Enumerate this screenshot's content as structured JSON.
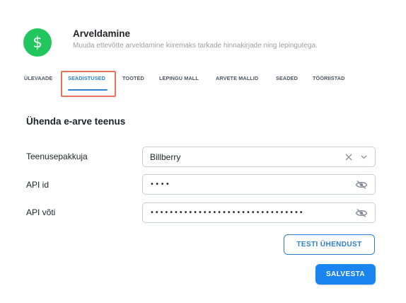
{
  "header": {
    "icon_glyph": "$",
    "icon_name": "dollar-icon",
    "title": "Arveldamine",
    "subtitle": "Muuda ettevõtte arveldamine kiiremaks tarkade hinnakirjade ning lepingutega."
  },
  "tabs": [
    {
      "label": "ÜLEVAADE",
      "active": false
    },
    {
      "label": "SEADISTUSED",
      "active": true
    },
    {
      "label": "TOOTED",
      "active": false
    },
    {
      "label": "LEPINGU MALL",
      "active": false
    },
    {
      "label": "ARVETE MALLID",
      "active": false
    },
    {
      "label": "SEADED",
      "active": false
    },
    {
      "label": "TÖÖRIISTAD",
      "active": false
    }
  ],
  "section": {
    "title": "Ühenda e-arve teenus"
  },
  "form": {
    "provider": {
      "label": "Teenusepakkuja",
      "value": "Billberry"
    },
    "api_id": {
      "label": "API id",
      "value": "••••"
    },
    "api_key": {
      "label": "API võti",
      "value": "••••••••••••••••••••••••••••••••"
    }
  },
  "buttons": {
    "test": "TESTI ÜHENDUST",
    "save": "SALVESTA"
  },
  "colors": {
    "accent": "#2e7fd6",
    "primary_button": "#1a84f0",
    "icon_bg": "#22c55e",
    "highlight": "#e8735a"
  }
}
